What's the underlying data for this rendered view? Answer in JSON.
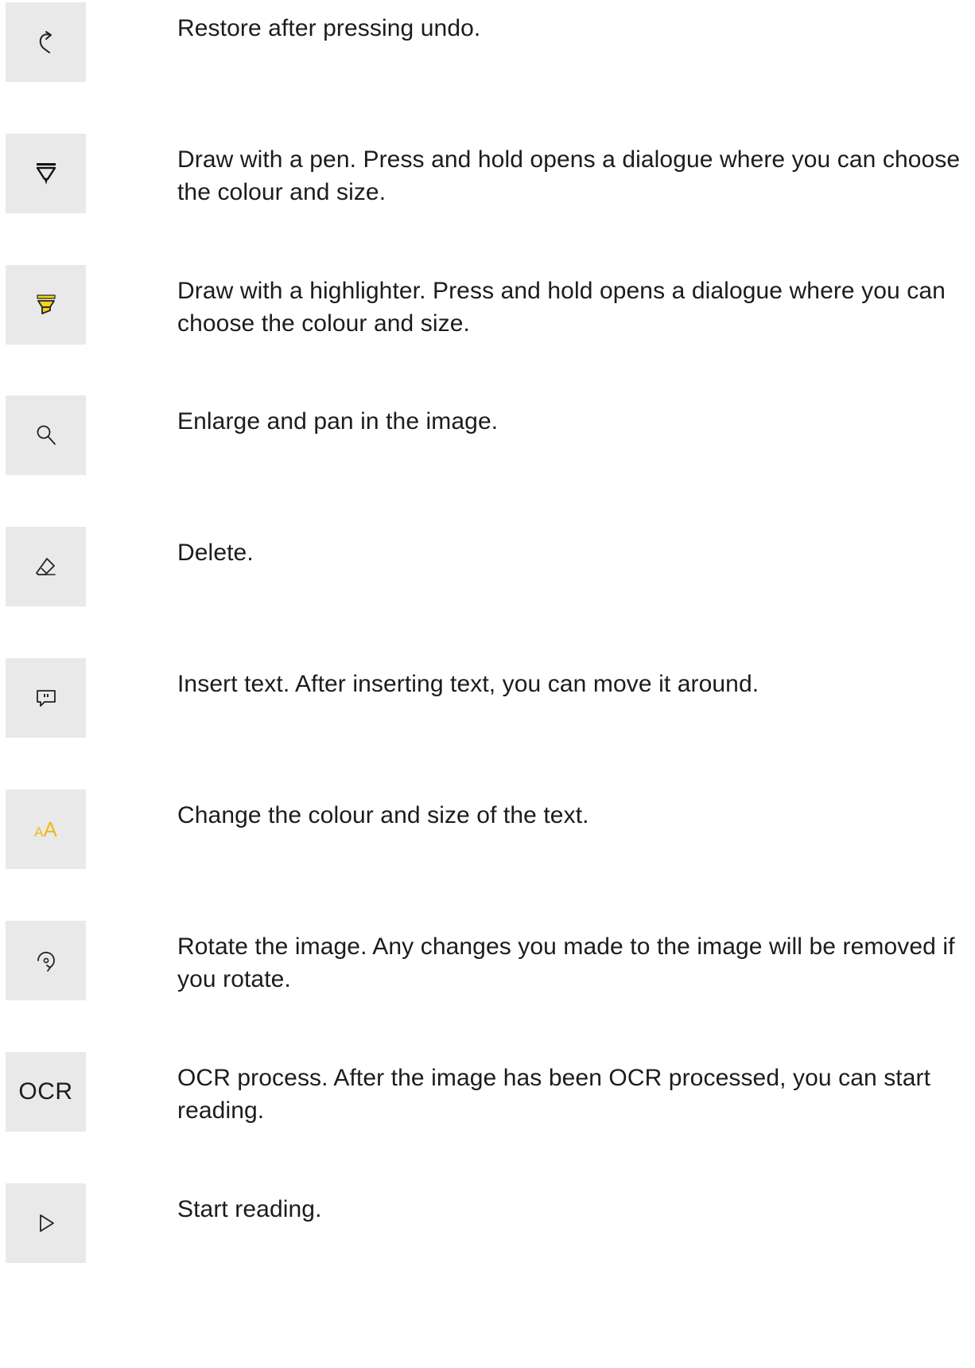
{
  "items": [
    {
      "icon": "redo-icon",
      "text": "Restore after pressing undo."
    },
    {
      "icon": "pen-icon",
      "text": "Draw with a pen. Press and hold opens a dialogue where you can choose the colour and size."
    },
    {
      "icon": "highlighter-icon",
      "text": "Draw with a highlighter. Press and hold opens a dialogue where you can choose the colour and size."
    },
    {
      "icon": "zoom-icon",
      "text": "Enlarge and pan in the image."
    },
    {
      "icon": "eraser-icon",
      "text": "Delete."
    },
    {
      "icon": "text-comment-icon",
      "text": "Insert text. After inserting text, you can move it around."
    },
    {
      "icon": "font-size-icon",
      "text": "Change the colour and size of the text.",
      "icon_small": "A",
      "icon_big": "A"
    },
    {
      "icon": "rotate-icon",
      "text": "Rotate the image. Any changes you made to the image will be removed if you rotate."
    },
    {
      "icon": "ocr-icon",
      "text": "OCR process. After the image has been OCR processed, you can start reading.",
      "icon_label": "OCR"
    },
    {
      "icon": "play-icon",
      "text": "Start reading."
    }
  ],
  "colors": {
    "icon_bg": "#e9e9e9",
    "highlight": "#f2b817",
    "text": "#1c1c1c"
  }
}
